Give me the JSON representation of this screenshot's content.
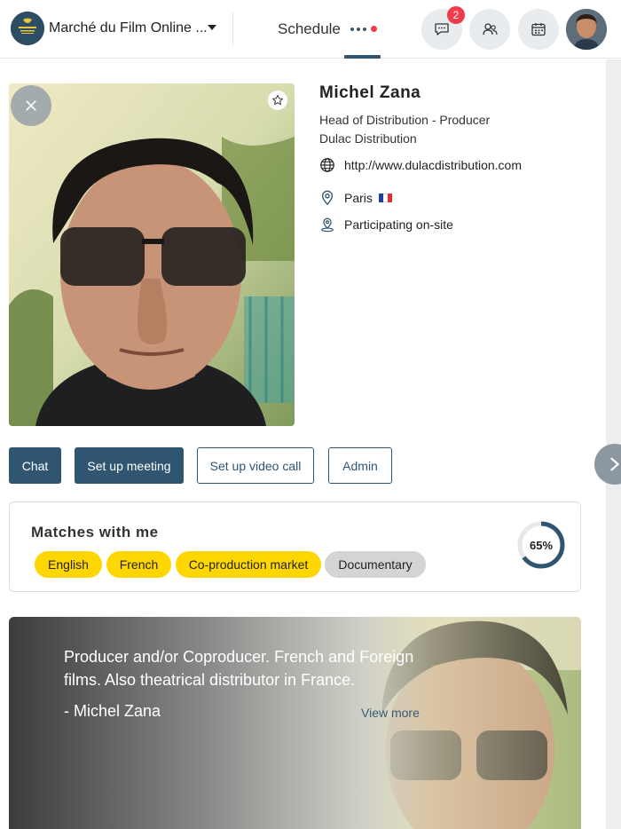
{
  "header": {
    "event_name": "Marché du Film Online ...",
    "schedule_tab": "Schedule",
    "chat_badge": "2",
    "icons": [
      "chat-icon",
      "people-icon",
      "calendar-icon"
    ]
  },
  "profile": {
    "name": "Michel Zana",
    "role": "Head of Distribution - Producer",
    "company": "Dulac Distribution",
    "website": "http://www.dulacdistribution.com",
    "location": "Paris",
    "participation": "Participating on-site"
  },
  "actions": {
    "chat": "Chat",
    "setup_meeting": "Set up meeting",
    "setup_video_call": "Set up video call",
    "admin": "Admin"
  },
  "matches": {
    "title": "Matches with me",
    "chips": [
      "English",
      "French",
      "Co-production market",
      "Documentary"
    ],
    "percent_label": "65%",
    "percent_value": 0.65
  },
  "quote": {
    "text": "Producer and/or Coproducer. French and Foreign films. Also theatrical distributor in France.",
    "author": "- Michel Zana",
    "view_more": "View more"
  },
  "colors": {
    "primary": "#2f5571",
    "chip_yellow": "#ffd700",
    "chip_grey": "#d4d4d4",
    "badge_red": "#ef3b4a"
  }
}
